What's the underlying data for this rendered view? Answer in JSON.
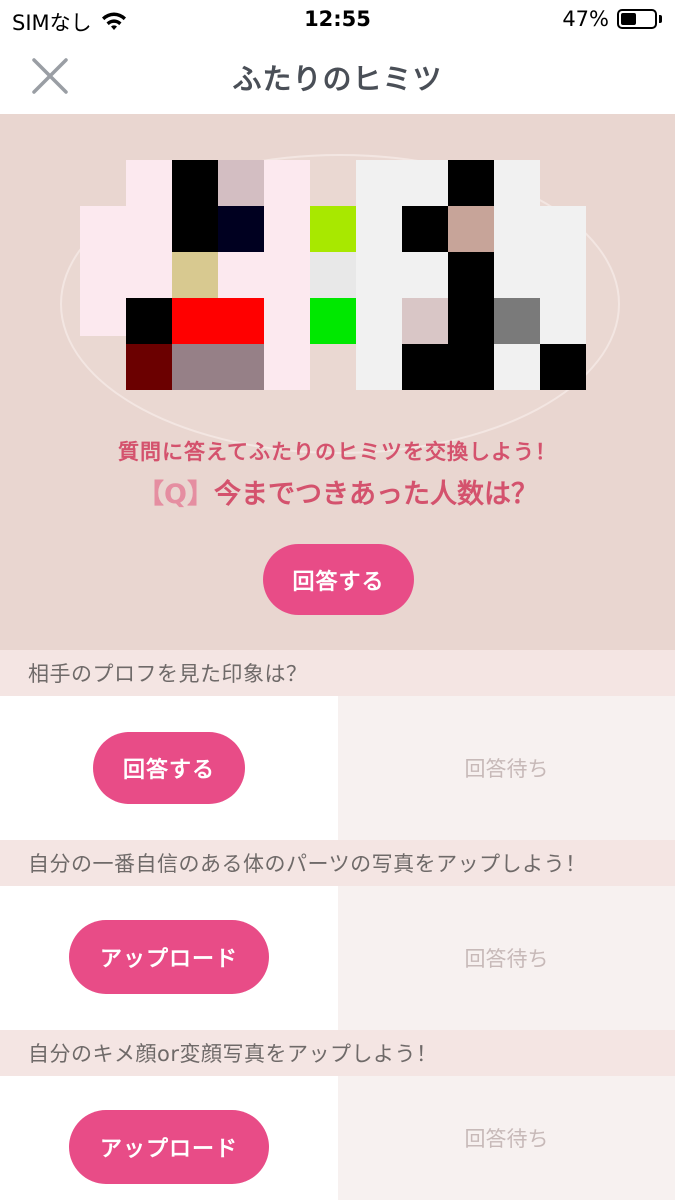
{
  "status_bar": {
    "carrier": "SIMなし",
    "time": "12:55",
    "battery": "47%"
  },
  "nav": {
    "title": "ふたりのヒミツ"
  },
  "hero": {
    "subtitle": "質問に答えてふたりのヒミツを交換しよう！",
    "question_prefix": "【Q】",
    "question_text": "今までつきあった人数は？",
    "button_label": "回答する"
  },
  "questions": [
    {
      "text": "相手のプロフを見た印象は？",
      "button_label": "回答する",
      "status": "回答待ち"
    },
    {
      "text": "自分の一番自信のある体のパーツの写真をアップしよう！",
      "button_label": "アップロード",
      "status": "回答待ち"
    },
    {
      "text": "自分のキメ顔or変顔写真をアップしよう！",
      "button_label": "アップロード",
      "status": "回答待ち"
    }
  ],
  "colors": {
    "accent": "#e84c87",
    "hero_bg": "#e9d6d0",
    "question_text": "#d4526d"
  }
}
